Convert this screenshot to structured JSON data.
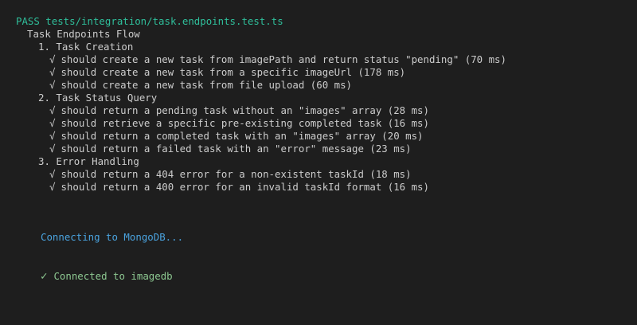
{
  "summary": {
    "pass_line": "PASS tests/integration/task.endpoints.test.ts",
    "suite": "Task Endpoints Flow"
  },
  "groups": [
    {
      "title": "1. Task Creation",
      "tests": [
        "should create a new task from imagePath and return status \"pending\" (70 ms)",
        "should create a new task from a specific imageUrl (178 ms)",
        "should create a new task from file upload (60 ms)"
      ]
    },
    {
      "title": "2. Task Status Query",
      "tests": [
        "should return a pending task without an \"images\" array (28 ms)",
        "should retrieve a specific pre-existing completed task (16 ms)",
        "should return a completed task with an \"images\" array (20 ms)",
        "should return a failed task with an \"error\" message (23 ms)"
      ]
    },
    {
      "title": "3. Error Handling",
      "tests": [
        "should return a 404 error for a non-existent taskId (18 ms)",
        "should return a 400 error for an invalid taskId format (16 ms)"
      ]
    }
  ],
  "test_check_glyph": "√",
  "logs": {
    "connecting": "Connecting to MongoDB...",
    "connected_glyph": "✓",
    "connected": "Connected to imagedb"
  },
  "colors": {
    "background": "#1e1e1e",
    "pass": "#2fbf9b",
    "text": "#cccccc",
    "connecting": "#4aa3df",
    "connected": "#8dc891"
  }
}
